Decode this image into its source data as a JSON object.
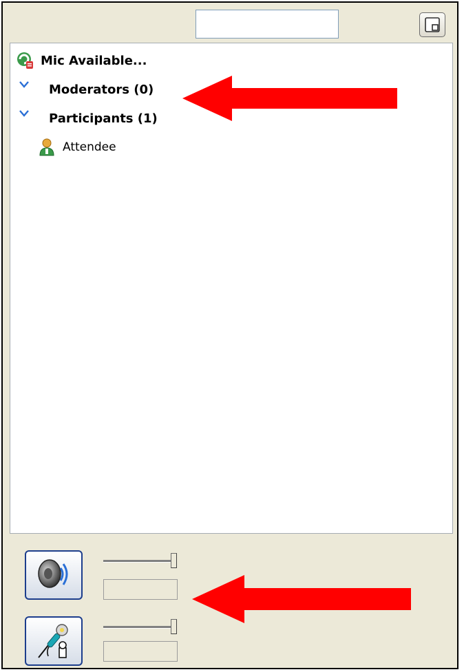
{
  "header": {
    "search_value": "",
    "undock_icon": "undock-window-icon"
  },
  "attendee_list": {
    "status": {
      "icon": "mic-status-icon",
      "label": "Mic Available..."
    },
    "groups": [
      {
        "icon": "chevron-down-icon",
        "label": "Moderators (0)"
      },
      {
        "icon": "chevron-down-icon",
        "label": "Participants (1)"
      }
    ],
    "members": [
      {
        "icon": "user-icon",
        "label": "Attendee"
      }
    ]
  },
  "audio_controls": {
    "speaker": {
      "icon": "speaker-icon",
      "volume_fraction": 0.95,
      "level_text": ""
    },
    "microphone": {
      "icon": "microphone-icon",
      "volume_fraction": 0.95,
      "level_text": ""
    }
  },
  "annotations": {
    "arrow_color": "#ff0000"
  },
  "colors": {
    "panel_bg": "#ece9d8",
    "link_blue": "#2a6fd6"
  }
}
